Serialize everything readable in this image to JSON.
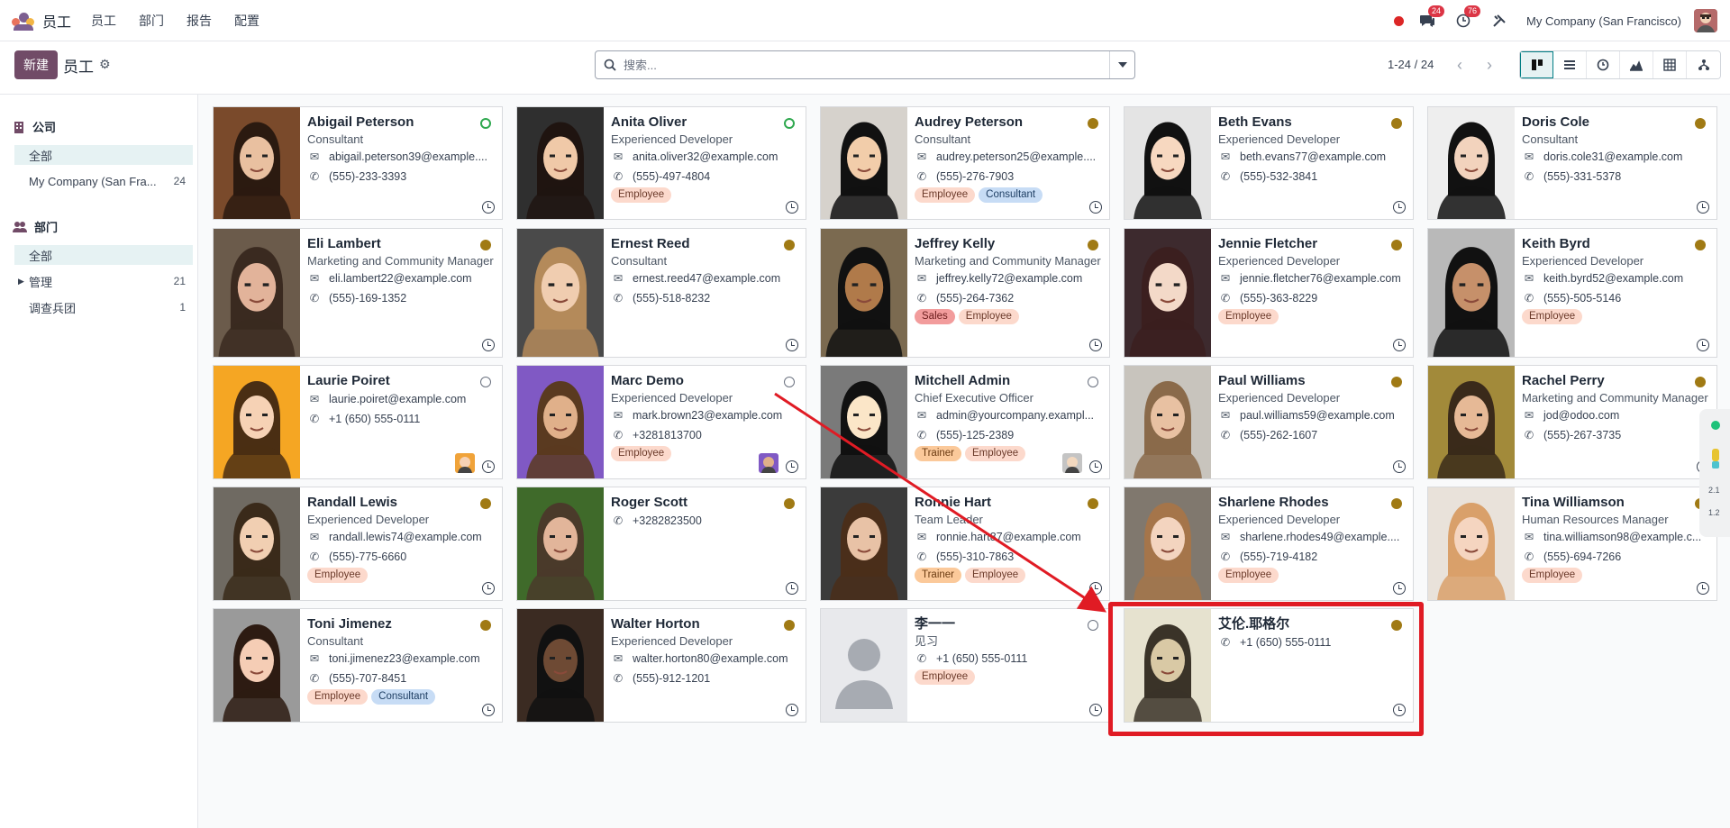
{
  "nav": {
    "app_name": "员工",
    "menu": [
      "员工",
      "部门",
      "报告",
      "配置"
    ],
    "chat_badge": "24",
    "activity_badge": "76",
    "company": "My Company (San Francisco)"
  },
  "control_panel": {
    "new_label": "新建",
    "title": "员工",
    "search_placeholder": "搜索...",
    "pager": "1-24 / 24"
  },
  "sidebar": {
    "company_title": "公司",
    "company_items": [
      {
        "label": "全部",
        "count": ""
      },
      {
        "label": "My Company (San Fra...",
        "count": "24"
      }
    ],
    "dept_title": "部门",
    "dept_items": [
      {
        "label": "全部",
        "count": ""
      },
      {
        "label": "管理",
        "count": "21"
      },
      {
        "label": "调查兵团",
        "count": "1"
      }
    ]
  },
  "employees": [
    {
      "name": "Abigail Peterson",
      "job": "Consultant",
      "email": "abigail.peterson39@example....",
      "phone": "(555)-233-3393",
      "tags": [],
      "status": "online"
    },
    {
      "name": "Anita Oliver",
      "job": "Experienced Developer",
      "email": "anita.oliver32@example.com",
      "phone": "(555)-497-4804",
      "tags": [
        "Employee"
      ],
      "status": "online"
    },
    {
      "name": "Audrey Peterson",
      "job": "Consultant",
      "email": "audrey.peterson25@example....",
      "phone": "(555)-276-7903",
      "tags": [
        "Employee",
        "Consultant"
      ],
      "status": "away"
    },
    {
      "name": "Beth Evans",
      "job": "Experienced Developer",
      "email": "beth.evans77@example.com",
      "phone": "(555)-532-3841",
      "tags": [],
      "status": "away"
    },
    {
      "name": "Doris Cole",
      "job": "Consultant",
      "email": "doris.cole31@example.com",
      "phone": "(555)-331-5378",
      "tags": [],
      "status": "away"
    },
    {
      "name": "Eli Lambert",
      "job": "Marketing and Community Manager",
      "email": "eli.lambert22@example.com",
      "phone": "(555)-169-1352",
      "tags": [],
      "status": "away"
    },
    {
      "name": "Ernest Reed",
      "job": "Consultant",
      "email": "ernest.reed47@example.com",
      "phone": "(555)-518-8232",
      "tags": [],
      "status": "away"
    },
    {
      "name": "Jeffrey Kelly",
      "job": "Marketing and Community Manager",
      "email": "jeffrey.kelly72@example.com",
      "phone": "(555)-264-7362",
      "tags": [
        "Sales",
        "Employee"
      ],
      "status": "away"
    },
    {
      "name": "Jennie Fletcher",
      "job": "Experienced Developer",
      "email": "jennie.fletcher76@example.com",
      "phone": "(555)-363-8229",
      "tags": [
        "Employee"
      ],
      "status": "away"
    },
    {
      "name": "Keith Byrd",
      "job": "Experienced Developer",
      "email": "keith.byrd52@example.com",
      "phone": "(555)-505-5146",
      "tags": [
        "Employee"
      ],
      "status": "away"
    },
    {
      "name": "Laurie Poiret",
      "job": "",
      "email": "laurie.poiret@example.com",
      "phone": "+1 (650) 555-0111",
      "tags": [],
      "status": "offline"
    },
    {
      "name": "Marc Demo",
      "job": "Experienced Developer",
      "email": "mark.brown23@example.com",
      "phone": "+3281813700",
      "tags": [
        "Employee"
      ],
      "status": "offline"
    },
    {
      "name": "Mitchell Admin",
      "job": "Chief Executive Officer",
      "email": "admin@yourcompany.exampl...",
      "phone": "(555)-125-2389",
      "tags": [
        "Trainer",
        "Employee"
      ],
      "status": "offline"
    },
    {
      "name": "Paul Williams",
      "job": "Experienced Developer",
      "email": "paul.williams59@example.com",
      "phone": "(555)-262-1607",
      "tags": [],
      "status": "away"
    },
    {
      "name": "Rachel Perry",
      "job": "Marketing and Community Manager",
      "email": "jod@odoo.com",
      "phone": "(555)-267-3735",
      "tags": [],
      "status": "away"
    },
    {
      "name": "Randall Lewis",
      "job": "Experienced Developer",
      "email": "randall.lewis74@example.com",
      "phone": "(555)-775-6660",
      "tags": [
        "Employee"
      ],
      "status": "away"
    },
    {
      "name": "Roger Scott",
      "job": "",
      "email": "",
      "phone": "+3282823500",
      "tags": [],
      "status": "away"
    },
    {
      "name": "Ronnie Hart",
      "job": "Team Leader",
      "email": "ronnie.hart87@example.com",
      "phone": "(555)-310-7863",
      "tags": [
        "Trainer",
        "Employee"
      ],
      "status": "away"
    },
    {
      "name": "Sharlene Rhodes",
      "job": "Experienced Developer",
      "email": "sharlene.rhodes49@example....",
      "phone": "(555)-719-4182",
      "tags": [
        "Employee"
      ],
      "status": "away"
    },
    {
      "name": "Tina Williamson",
      "job": "Human Resources Manager",
      "email": "tina.williamson98@example.c...",
      "phone": "(555)-694-7266",
      "tags": [
        "Employee"
      ],
      "status": "away"
    },
    {
      "name": "Toni Jimenez",
      "job": "Consultant",
      "email": "toni.jimenez23@example.com",
      "phone": "(555)-707-8451",
      "tags": [
        "Employee",
        "Consultant"
      ],
      "status": "away"
    },
    {
      "name": "Walter Horton",
      "job": "Experienced Developer",
      "email": "walter.horton80@example.com",
      "phone": "(555)-912-1201",
      "tags": [],
      "status": "away"
    },
    {
      "name": "李一一",
      "job": "见习",
      "email": "",
      "phone": "+1 (650) 555-0111",
      "tags": [
        "Employee"
      ],
      "status": "offline"
    },
    {
      "name": "艾伦.耶格尔",
      "job": "",
      "email": "",
      "phone": "+1 (650) 555-0111",
      "tags": [],
      "status": "away"
    }
  ],
  "colors": {
    "brand": "#714b67",
    "accent": "#017e84",
    "highlight": "#e01b24"
  }
}
